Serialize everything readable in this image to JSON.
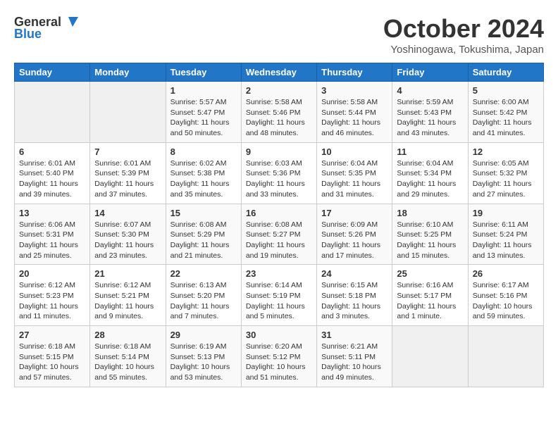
{
  "header": {
    "logo_general": "General",
    "logo_blue": "Blue",
    "month": "October 2024",
    "location": "Yoshinogawa, Tokushima, Japan"
  },
  "days_of_week": [
    "Sunday",
    "Monday",
    "Tuesday",
    "Wednesday",
    "Thursday",
    "Friday",
    "Saturday"
  ],
  "weeks": [
    {
      "days": [
        {
          "number": "",
          "info": ""
        },
        {
          "number": "",
          "info": ""
        },
        {
          "number": "1",
          "info": "Sunrise: 5:57 AM\nSunset: 5:47 PM\nDaylight: 11 hours and 50 minutes."
        },
        {
          "number": "2",
          "info": "Sunrise: 5:58 AM\nSunset: 5:46 PM\nDaylight: 11 hours and 48 minutes."
        },
        {
          "number": "3",
          "info": "Sunrise: 5:58 AM\nSunset: 5:44 PM\nDaylight: 11 hours and 46 minutes."
        },
        {
          "number": "4",
          "info": "Sunrise: 5:59 AM\nSunset: 5:43 PM\nDaylight: 11 hours and 43 minutes."
        },
        {
          "number": "5",
          "info": "Sunrise: 6:00 AM\nSunset: 5:42 PM\nDaylight: 11 hours and 41 minutes."
        }
      ]
    },
    {
      "days": [
        {
          "number": "6",
          "info": "Sunrise: 6:01 AM\nSunset: 5:40 PM\nDaylight: 11 hours and 39 minutes."
        },
        {
          "number": "7",
          "info": "Sunrise: 6:01 AM\nSunset: 5:39 PM\nDaylight: 11 hours and 37 minutes."
        },
        {
          "number": "8",
          "info": "Sunrise: 6:02 AM\nSunset: 5:38 PM\nDaylight: 11 hours and 35 minutes."
        },
        {
          "number": "9",
          "info": "Sunrise: 6:03 AM\nSunset: 5:36 PM\nDaylight: 11 hours and 33 minutes."
        },
        {
          "number": "10",
          "info": "Sunrise: 6:04 AM\nSunset: 5:35 PM\nDaylight: 11 hours and 31 minutes."
        },
        {
          "number": "11",
          "info": "Sunrise: 6:04 AM\nSunset: 5:34 PM\nDaylight: 11 hours and 29 minutes."
        },
        {
          "number": "12",
          "info": "Sunrise: 6:05 AM\nSunset: 5:32 PM\nDaylight: 11 hours and 27 minutes."
        }
      ]
    },
    {
      "days": [
        {
          "number": "13",
          "info": "Sunrise: 6:06 AM\nSunset: 5:31 PM\nDaylight: 11 hours and 25 minutes."
        },
        {
          "number": "14",
          "info": "Sunrise: 6:07 AM\nSunset: 5:30 PM\nDaylight: 11 hours and 23 minutes."
        },
        {
          "number": "15",
          "info": "Sunrise: 6:08 AM\nSunset: 5:29 PM\nDaylight: 11 hours and 21 minutes."
        },
        {
          "number": "16",
          "info": "Sunrise: 6:08 AM\nSunset: 5:27 PM\nDaylight: 11 hours and 19 minutes."
        },
        {
          "number": "17",
          "info": "Sunrise: 6:09 AM\nSunset: 5:26 PM\nDaylight: 11 hours and 17 minutes."
        },
        {
          "number": "18",
          "info": "Sunrise: 6:10 AM\nSunset: 5:25 PM\nDaylight: 11 hours and 15 minutes."
        },
        {
          "number": "19",
          "info": "Sunrise: 6:11 AM\nSunset: 5:24 PM\nDaylight: 11 hours and 13 minutes."
        }
      ]
    },
    {
      "days": [
        {
          "number": "20",
          "info": "Sunrise: 6:12 AM\nSunset: 5:23 PM\nDaylight: 11 hours and 11 minutes."
        },
        {
          "number": "21",
          "info": "Sunrise: 6:12 AM\nSunset: 5:21 PM\nDaylight: 11 hours and 9 minutes."
        },
        {
          "number": "22",
          "info": "Sunrise: 6:13 AM\nSunset: 5:20 PM\nDaylight: 11 hours and 7 minutes."
        },
        {
          "number": "23",
          "info": "Sunrise: 6:14 AM\nSunset: 5:19 PM\nDaylight: 11 hours and 5 minutes."
        },
        {
          "number": "24",
          "info": "Sunrise: 6:15 AM\nSunset: 5:18 PM\nDaylight: 11 hours and 3 minutes."
        },
        {
          "number": "25",
          "info": "Sunrise: 6:16 AM\nSunset: 5:17 PM\nDaylight: 11 hours and 1 minute."
        },
        {
          "number": "26",
          "info": "Sunrise: 6:17 AM\nSunset: 5:16 PM\nDaylight: 10 hours and 59 minutes."
        }
      ]
    },
    {
      "days": [
        {
          "number": "27",
          "info": "Sunrise: 6:18 AM\nSunset: 5:15 PM\nDaylight: 10 hours and 57 minutes."
        },
        {
          "number": "28",
          "info": "Sunrise: 6:18 AM\nSunset: 5:14 PM\nDaylight: 10 hours and 55 minutes."
        },
        {
          "number": "29",
          "info": "Sunrise: 6:19 AM\nSunset: 5:13 PM\nDaylight: 10 hours and 53 minutes."
        },
        {
          "number": "30",
          "info": "Sunrise: 6:20 AM\nSunset: 5:12 PM\nDaylight: 10 hours and 51 minutes."
        },
        {
          "number": "31",
          "info": "Sunrise: 6:21 AM\nSunset: 5:11 PM\nDaylight: 10 hours and 49 minutes."
        },
        {
          "number": "",
          "info": ""
        },
        {
          "number": "",
          "info": ""
        }
      ]
    }
  ]
}
